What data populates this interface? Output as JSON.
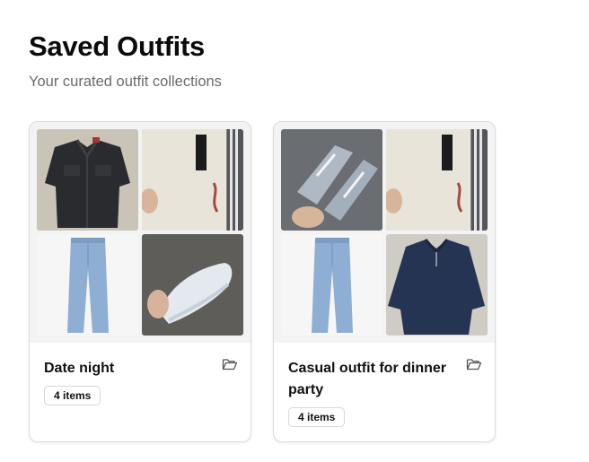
{
  "header": {
    "title": "Saved Outfits",
    "subtitle": "Your curated outfit collections"
  },
  "outfits": [
    {
      "name": "Date night",
      "count_label": "4 items",
      "items": [
        "denim-jacket-photo",
        "beige-tshirt-photo",
        "blue-jeans-photo",
        "white-sneakers-photo"
      ]
    },
    {
      "name": "Casual outfit for dinner party",
      "count_label": "4 items",
      "items": [
        "grey-sneakers-photo",
        "beige-tshirt-photo",
        "blue-jeans-photo",
        "navy-sweater-photo"
      ]
    }
  ],
  "icons": {
    "collection": "folder-open-icon"
  },
  "colors": {
    "background": "#ffffff",
    "card_border": "#dcdcdc",
    "muted_text": "#6b6b6b"
  }
}
